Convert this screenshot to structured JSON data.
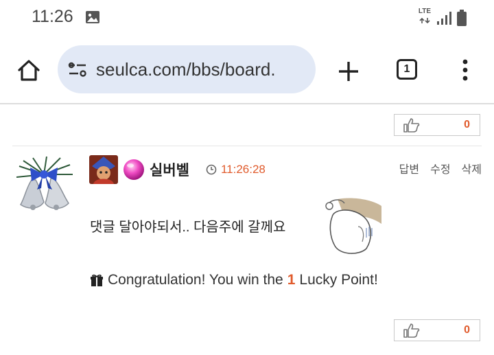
{
  "status_bar": {
    "time": "11:26",
    "network": "LTE",
    "icons": [
      "image-icon",
      "lte-icon",
      "signal-icon",
      "battery-icon"
    ]
  },
  "browser": {
    "url": "seulca.com/bbs/board.",
    "tab_count": "1",
    "icons": [
      "home-icon",
      "site-settings-icon",
      "new-tab-icon",
      "tab-switcher-icon",
      "more-menu-icon"
    ]
  },
  "prev_post": {
    "like_count": "0"
  },
  "comment": {
    "username": "실버벨",
    "time": "11:26:28",
    "actions": {
      "reply": "답변",
      "edit": "수정",
      "delete": "삭제"
    },
    "body": "댓글 달아야되서..  다음주에 갈께요",
    "lucky_prefix": "Congratulation! You win the",
    "lucky_number": "1",
    "lucky_suffix": "Lucky Point!",
    "like_count": "0"
  },
  "colors": {
    "accent": "#e05a2b",
    "urlbar_bg": "#e2e9f6"
  }
}
